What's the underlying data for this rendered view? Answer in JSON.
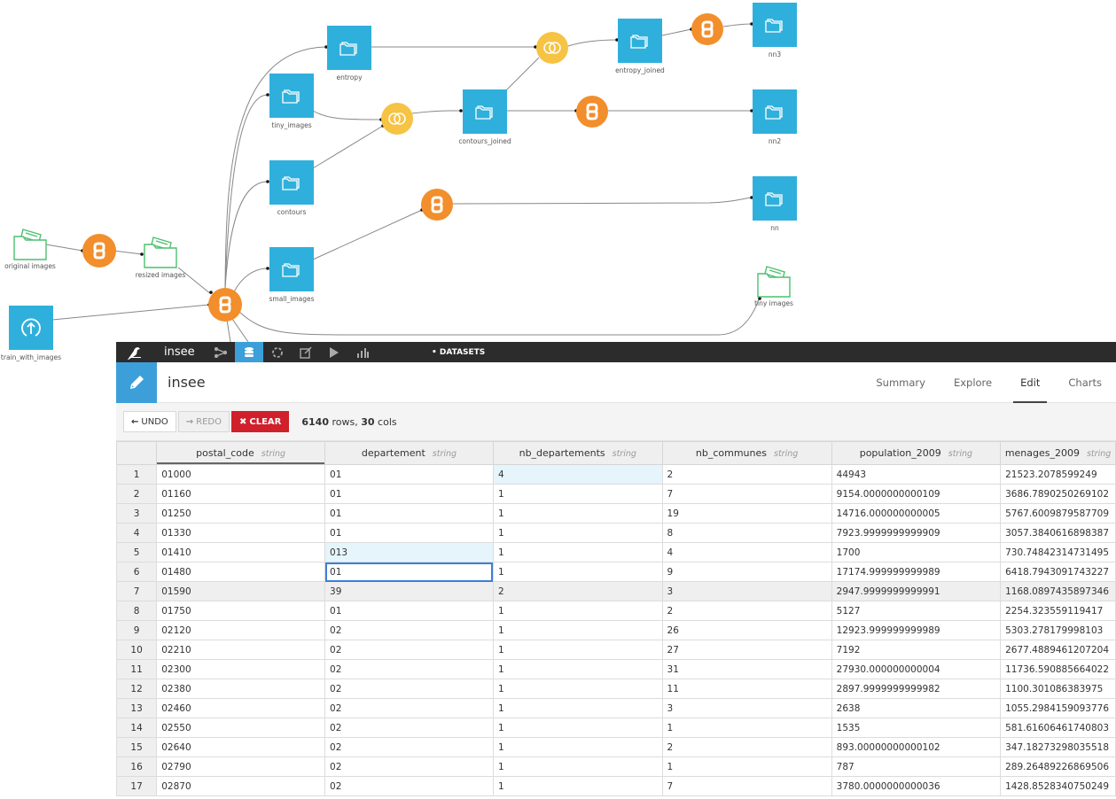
{
  "flow": {
    "datasets": [
      {
        "id": "entropy",
        "label": "entropy",
        "kind": "dataset"
      },
      {
        "id": "tiny_images",
        "label": "tiny_images",
        "kind": "dataset"
      },
      {
        "id": "contours",
        "label": "contours",
        "kind": "dataset"
      },
      {
        "id": "small_images",
        "label": "small_images",
        "kind": "dataset"
      },
      {
        "id": "contours_joined",
        "label": "contours_joined",
        "kind": "dataset"
      },
      {
        "id": "entropy_joined",
        "label": "entropy_joined",
        "kind": "dataset"
      },
      {
        "id": "nn3",
        "label": "nn3",
        "kind": "dataset"
      },
      {
        "id": "nn2",
        "label": "nn2",
        "kind": "dataset"
      },
      {
        "id": "nn",
        "label": "nn",
        "kind": "dataset"
      },
      {
        "id": "train_with_images",
        "label": "train_with_images",
        "kind": "upload"
      },
      {
        "id": "original_images",
        "label": "original images",
        "kind": "folder"
      },
      {
        "id": "resized_images",
        "label": "resized images",
        "kind": "folder"
      },
      {
        "id": "tiny_images_folder",
        "label": "tiny images",
        "kind": "folder"
      }
    ],
    "recipes": [
      {
        "id": "py_resize",
        "type": "python"
      },
      {
        "id": "py_main",
        "type": "python"
      },
      {
        "id": "join_contours",
        "type": "join"
      },
      {
        "id": "join_entropy",
        "type": "join"
      },
      {
        "id": "py_nn3",
        "type": "python"
      },
      {
        "id": "py_nn2",
        "type": "python"
      },
      {
        "id": "py_nn",
        "type": "python"
      }
    ],
    "colors": {
      "dataset": "#2fb0dc",
      "python": "#f28e2b",
      "join": "#f6c343",
      "folder": "#4cc06e"
    }
  },
  "topbar": {
    "project": "insee",
    "section": "• DATASETS",
    "icons": [
      "bird-logo-icon",
      "flow-icon",
      "datasets-icon",
      "recipes-icon",
      "notebooks-icon",
      "jobs-icon",
      "dashboards-icon"
    ]
  },
  "title": {
    "dataset_name": "insee"
  },
  "tabs": [
    {
      "label": "Summary",
      "active": false
    },
    {
      "label": "Explore",
      "active": false
    },
    {
      "label": "Edit",
      "active": true
    },
    {
      "label": "Charts",
      "active": false
    }
  ],
  "toolbar": {
    "undo": "UNDO",
    "redo": "REDO",
    "clear": "CLEAR",
    "rows": "6140",
    "rows_suffix": " rows, ",
    "cols": "30",
    "cols_suffix": " cols"
  },
  "table": {
    "columns": [
      {
        "name": "postal_code",
        "type": "string"
      },
      {
        "name": "departement",
        "type": "string"
      },
      {
        "name": "nb_departements",
        "type": "string"
      },
      {
        "name": "nb_communes",
        "type": "string"
      },
      {
        "name": "population_2009",
        "type": "string"
      },
      {
        "name": "menages_2009",
        "type": "string"
      }
    ],
    "rows": [
      [
        "1",
        "01000",
        "01",
        "4",
        "2",
        "44943",
        "21523.2078599249"
      ],
      [
        "2",
        "01160",
        "01",
        "1",
        "7",
        "9154.0000000000109",
        "3686.7890250269102"
      ],
      [
        "3",
        "01250",
        "01",
        "1",
        "19",
        "14716.000000000005",
        "5767.6009879587709"
      ],
      [
        "4",
        "01330",
        "01",
        "1",
        "8",
        "7923.9999999999909",
        "3057.3840616898387"
      ],
      [
        "5",
        "01410",
        "013",
        "1",
        "4",
        "1700",
        "730.74842314731495"
      ],
      [
        "6",
        "01480",
        "01",
        "1",
        "9",
        "17174.999999999989",
        "6418.7943091743227"
      ],
      [
        "7",
        "01590",
        "39",
        "2",
        "3",
        "2947.9999999999991",
        "1168.0897435897346"
      ],
      [
        "8",
        "01750",
        "01",
        "1",
        "2",
        "5127",
        "2254.323559119417"
      ],
      [
        "9",
        "02120",
        "02",
        "1",
        "26",
        "12923.999999999989",
        "5303.278179998103"
      ],
      [
        "10",
        "02210",
        "02",
        "1",
        "27",
        "7192",
        "2677.4889461207204"
      ],
      [
        "11",
        "02300",
        "02",
        "1",
        "31",
        "27930.000000000004",
        "11736.590885664022"
      ],
      [
        "12",
        "02380",
        "02",
        "1",
        "11",
        "2897.9999999999982",
        "1100.301086383975"
      ],
      [
        "13",
        "02460",
        "02",
        "1",
        "3",
        "2638",
        "1055.2984159093776"
      ],
      [
        "14",
        "02550",
        "02",
        "1",
        "1",
        "1535",
        "581.61606461740803"
      ],
      [
        "15",
        "02640",
        "02",
        "1",
        "2",
        "893.00000000000102",
        "347.18273298035518"
      ],
      [
        "16",
        "02790",
        "02",
        "1",
        "1",
        "787",
        "289.26489226869506"
      ],
      [
        "17",
        "02870",
        "02",
        "1",
        "7",
        "3780.0000000000036",
        "1428.8528340750249"
      ]
    ],
    "highlighted_cells": [
      [
        0,
        3
      ],
      [
        4,
        2
      ]
    ],
    "selected_cell": [
      5,
      2
    ],
    "alt_row": 6
  }
}
